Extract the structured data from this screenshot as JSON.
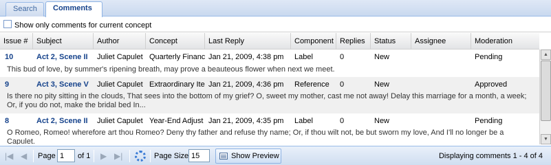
{
  "tabs": [
    {
      "label": "Search",
      "active": false
    },
    {
      "label": "Comments",
      "active": true
    }
  ],
  "filter": {
    "label": "Show only comments for current concept",
    "checked": false
  },
  "columns": [
    "Issue #",
    "Subject",
    "Author",
    "Concept",
    "Last Reply",
    "Component",
    "Replies",
    "Status",
    "Assignee",
    "Moderation"
  ],
  "rows": [
    {
      "issue": "10",
      "subject": "Act 2, Scene II",
      "author": "Juliet Capulet",
      "concept": "Quarterly Financ",
      "last_reply": "Jan 21, 2009, 4:38 pm",
      "component": "Label",
      "replies": "0",
      "status": "New",
      "assignee": "",
      "moderation": "Pending",
      "preview": "This bud of love, by summer's ripening breath, may prove a beauteous flower when next we meet."
    },
    {
      "issue": "9",
      "subject": "Act 3, Scene V",
      "author": "Juliet Capulet",
      "concept": "Extraordinary Iter",
      "last_reply": "Jan 21, 2009, 4:36 pm",
      "component": "Reference",
      "replies": "0",
      "status": "New",
      "assignee": "",
      "moderation": "Approved",
      "preview": "Is there no pity sitting in the clouds, That sees into the bottom of my grief? O, sweet my mother, cast me not away! Delay this marriage for a month, a week; Or, if you do not, make the bridal bed In..."
    },
    {
      "issue": "8",
      "subject": "Act 2, Scene II",
      "author": "Juliet Capulet",
      "concept": "Year-End Adjust",
      "last_reply": "Jan 21, 2009, 4:35 pm",
      "component": "Label",
      "replies": "0",
      "status": "New",
      "assignee": "",
      "moderation": "Pending",
      "preview": "O Romeo, Romeo! wherefore art thou Romeo? Deny thy father and refuse thy name; Or, if thou wilt not, be but sworn my love, And I'll no longer be a Capulet."
    }
  ],
  "pager": {
    "page_label": "Page",
    "page_value": "1",
    "of_label": "of 1",
    "page_size_label": "Page Size",
    "page_size_value": "15",
    "show_preview_label": "Show Preview",
    "display_msg": "Displaying comments 1 - 4 of 4"
  },
  "icons": {
    "first": "first-page-icon",
    "prev": "prev-page-icon",
    "next": "next-page-icon",
    "last": "last-page-icon",
    "refresh": "refresh-icon",
    "preview": "preview-icon"
  },
  "colors": {
    "link": "#15428b",
    "tab_border": "#99bbe8",
    "row_alt": "#f0f0f0"
  }
}
